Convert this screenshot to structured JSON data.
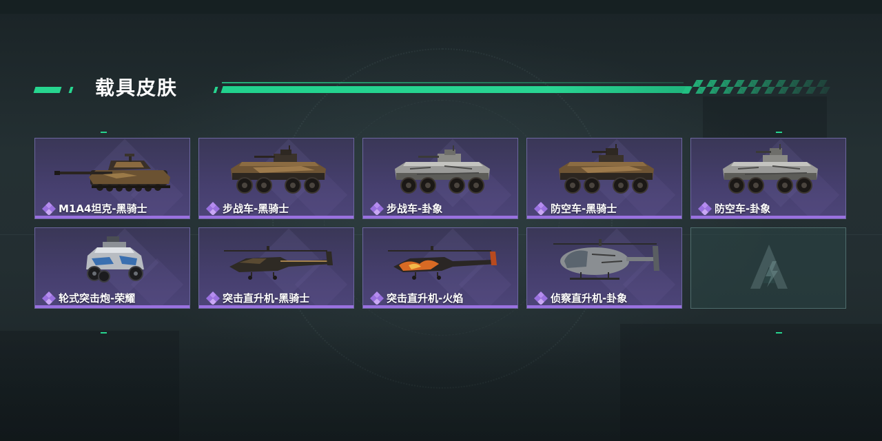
{
  "section": {
    "title": "载具皮肤"
  },
  "colors": {
    "accent": "#27d58f",
    "card_bg": "#463f6e",
    "card_border": "#6d67a0",
    "card_underline": "#9a71e0",
    "gem": "#b58cf0"
  },
  "skins": [
    {
      "label": "M1A4坦克-黑骑士",
      "icon": "tank-icon"
    },
    {
      "label": "步战车-黑骑士",
      "icon": "ifv-icon"
    },
    {
      "label": "步战车-卦象",
      "icon": "ifv-icon"
    },
    {
      "label": "防空车-黑骑士",
      "icon": "aa-vehicle-icon"
    },
    {
      "label": "防空车-卦象",
      "icon": "aa-vehicle-icon"
    },
    {
      "label": "轮式突击炮-荣耀",
      "icon": "buggy-icon"
    },
    {
      "label": "突击直升机-黑骑士",
      "icon": "attack-helicopter-icon"
    },
    {
      "label": "突击直升机-火焰",
      "icon": "attack-helicopter-icon"
    },
    {
      "label": "侦察直升机-卦象",
      "icon": "scout-helicopter-icon"
    }
  ],
  "empty_slot": {
    "icon": "game-logo-icon"
  }
}
